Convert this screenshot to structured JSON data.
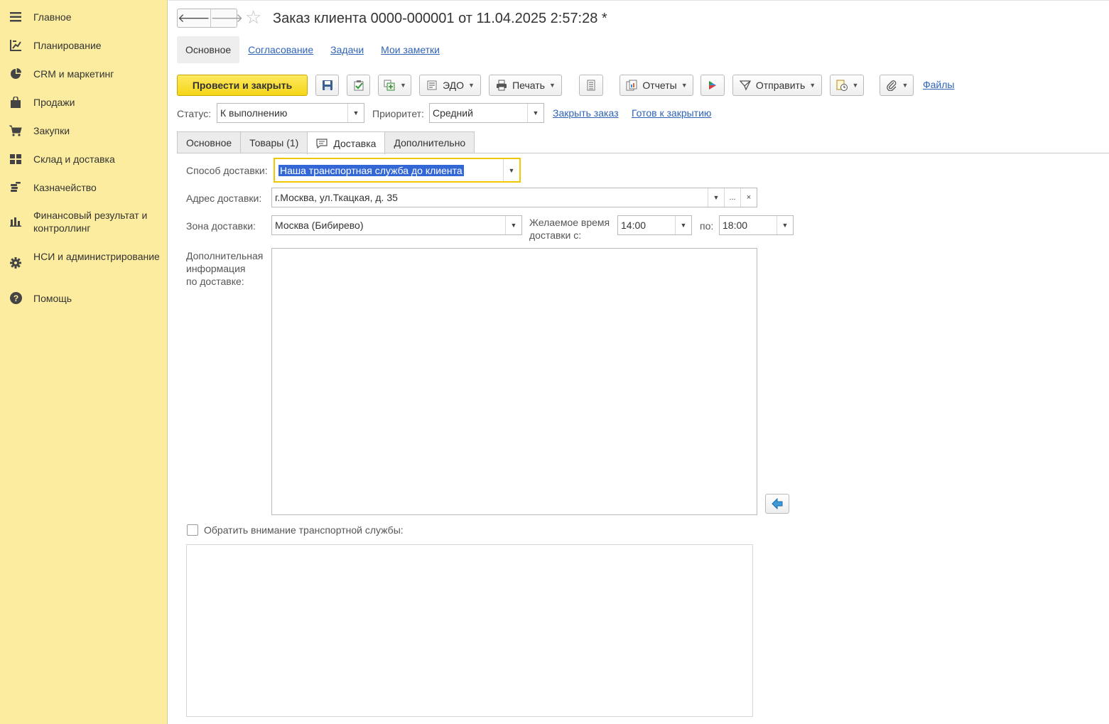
{
  "sidebar": {
    "items": [
      {
        "label": "Главное",
        "icon": "hamburger-icon"
      },
      {
        "label": "Планирование",
        "icon": "planning-icon"
      },
      {
        "label": "CRM и маркетинг",
        "icon": "pie-chart-icon"
      },
      {
        "label": "Продажи",
        "icon": "shopping-bag-icon"
      },
      {
        "label": "Закупки",
        "icon": "cart-icon"
      },
      {
        "label": "Склад и доставка",
        "icon": "warehouse-grid-icon"
      },
      {
        "label": "Казначейство",
        "icon": "coins-icon"
      },
      {
        "label": "Финансовый результат и контроллинг",
        "icon": "bar-chart-icon"
      },
      {
        "label": "НСИ и администрирование",
        "icon": "gear-icon"
      },
      {
        "label": "Помощь",
        "icon": "question-icon"
      }
    ]
  },
  "header": {
    "title": "Заказ клиента 0000-000001 от 11.04.2025 2:57:28 *",
    "back_glyph": "🡐",
    "forward_glyph": "🡒",
    "star_glyph": "☆"
  },
  "panel_tabs": [
    "Основное",
    "Согласование",
    "Задачи",
    "Мои заметки"
  ],
  "toolbar": {
    "post_close": "Провести и закрыть",
    "edo": "ЭДО",
    "print": "Печать",
    "reports": "Отчеты",
    "send": "Отправить",
    "files": "Файлы"
  },
  "status_row": {
    "status_label": "Статус:",
    "status_value": "К выполнению",
    "priority_label": "Приоритет:",
    "priority_value": "Средний",
    "close_order": "Закрыть заказ",
    "ready_to_close": "Готов к закрытию"
  },
  "tabs": [
    "Основное",
    "Товары (1)",
    "Доставка",
    "Дополнительно"
  ],
  "delivery": {
    "method_label": "Способ доставки:",
    "method_value": "Наша транспортная служба до клиента",
    "address_label": "Адрес доставки:",
    "address_value": "г.Москва, ул.Ткацкая, д. 35",
    "zone_label": "Зона доставки:",
    "zone_value": "Москва (Бибирево)",
    "desired_time_label_1": "Желаемое время",
    "desired_time_label_2": "доставки с:",
    "time_from": "14:00",
    "to_label": "по:",
    "time_to": "18:00",
    "extra_info_label_1": "Дополнительная",
    "extra_info_label_2": "информация",
    "extra_info_label_3": "по доставке:",
    "attention_label": "Обратить внимание транспортной службы:",
    "ellipsis": "...",
    "clear": "×"
  },
  "glyphs": {
    "caret": "▼"
  },
  "colors": {
    "sidebar_bg": "#fcec9f",
    "primary_button": "#f5d619",
    "link": "#3064b8",
    "selection": "#3367d6"
  }
}
